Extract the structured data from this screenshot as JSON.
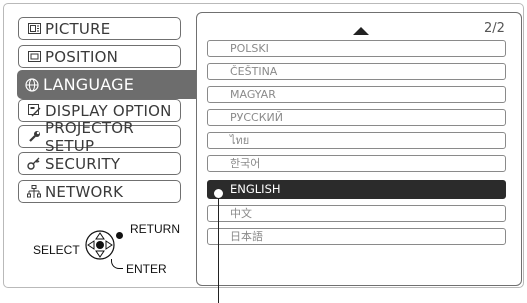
{
  "menu": {
    "items": [
      {
        "label": "PICTURE",
        "icon": "picture-icon"
      },
      {
        "label": "POSITION",
        "icon": "position-icon"
      },
      {
        "label": "LANGUAGE",
        "icon": "globe-icon",
        "selected": true
      },
      {
        "label": "DISPLAY OPTION",
        "icon": "display-option-icon"
      },
      {
        "label": "PROJECTOR SETUP",
        "icon": "wrench-icon"
      },
      {
        "label": "SECURITY",
        "icon": "key-icon"
      },
      {
        "label": "NETWORK",
        "icon": "network-icon"
      }
    ]
  },
  "language_list": {
    "page_indicator": "2/2",
    "items": [
      "POLSKI",
      "ČEŠTINA",
      "MAGYAR",
      "РУССКИЙ",
      "ไทย",
      "한국어",
      "ENGLISH",
      "中文",
      "日本語"
    ],
    "selected": "ENGLISH"
  },
  "legend": {
    "select_label": "SELECT",
    "return_label": "RETURN",
    "enter_label": "ENTER"
  },
  "colors": {
    "selected_menu_bg": "#6d6d6d",
    "selected_item_bg": "#2b2b2b",
    "border": "#707070"
  }
}
